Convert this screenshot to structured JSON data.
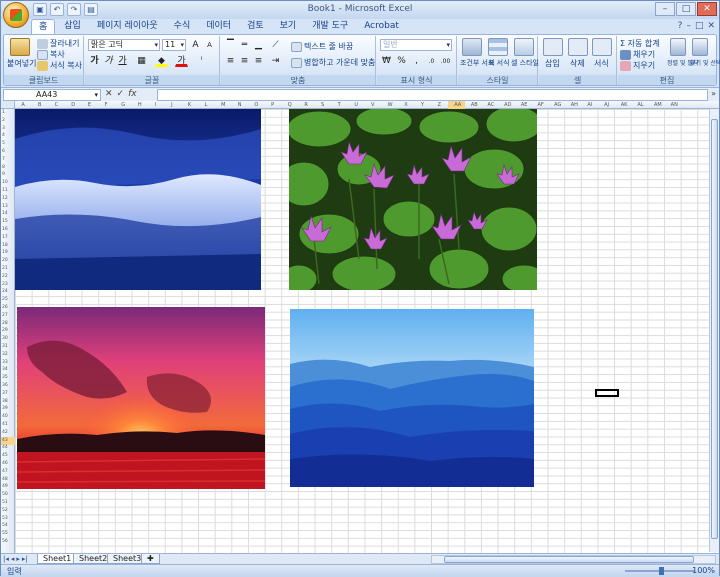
{
  "window": {
    "title": "Book1 - Microsoft Excel"
  },
  "tabs": [
    "홈",
    "삽입",
    "페이지 레이아웃",
    "수식",
    "데이터",
    "검토",
    "보기",
    "개발 도구",
    "Acrobat"
  ],
  "ribbon": {
    "clipboard": {
      "label": "클립보드",
      "paste": "붙여넣기",
      "cut": "잘라내기",
      "copy": "복사",
      "format_painter": "서식 복사"
    },
    "font": {
      "label": "글꼴",
      "font_name": "맑은 고딕",
      "font_size": "11",
      "bold": "가",
      "italic": "가",
      "underline": "가"
    },
    "alignment": {
      "label": "맞춤",
      "wrap_text": "텍스트 줄 바꿈",
      "merge_center": "병합하고 가운데 맞춤"
    },
    "number": {
      "label": "표시 형식",
      "format": "일반",
      "currency": "₩",
      "percent": "%"
    },
    "styles": {
      "label": "스타일",
      "conditional": "조건부 서식",
      "table": "표 서식",
      "cell_styles": "셀 스타일"
    },
    "cells": {
      "label": "셀",
      "insert": "삽입",
      "delete": "삭제",
      "format": "서식"
    },
    "editing": {
      "label": "편집",
      "autosum": "자동 합계",
      "fill": "채우기",
      "clear": "지우기",
      "sort_filter": "정렬 및 필터",
      "find_select": "찾기 및 선택"
    }
  },
  "formula_bar": {
    "name_box": "AA43",
    "formula": "",
    "fx": "fx"
  },
  "columns": [
    "A",
    "B",
    "C",
    "D",
    "E",
    "F",
    "G",
    "H",
    "I",
    "J",
    "K",
    "L",
    "M",
    "N",
    "O",
    "P",
    "Q",
    "R",
    "S",
    "T",
    "U",
    "V",
    "W",
    "X",
    "Y",
    "Z",
    "AA",
    "AB",
    "AC",
    "AD",
    "AE",
    "AF",
    "AG",
    "AH",
    "AI",
    "AJ",
    "AK",
    "AL",
    "AM",
    "AN"
  ],
  "selected": {
    "column": "AA",
    "row": 43
  },
  "pictures": [
    {
      "name": "winter-forest",
      "label": "Blue Hills"
    },
    {
      "name": "water-lilies",
      "label": "Water lilies"
    },
    {
      "name": "sunset",
      "label": "Sunset"
    },
    {
      "name": "blue-hills",
      "label": "Blue hills"
    }
  ],
  "sheets": [
    "Sheet1",
    "Sheet2",
    "Sheet3"
  ],
  "active_sheet": "Sheet1",
  "status": {
    "mode": "입력",
    "zoom": "100%"
  }
}
